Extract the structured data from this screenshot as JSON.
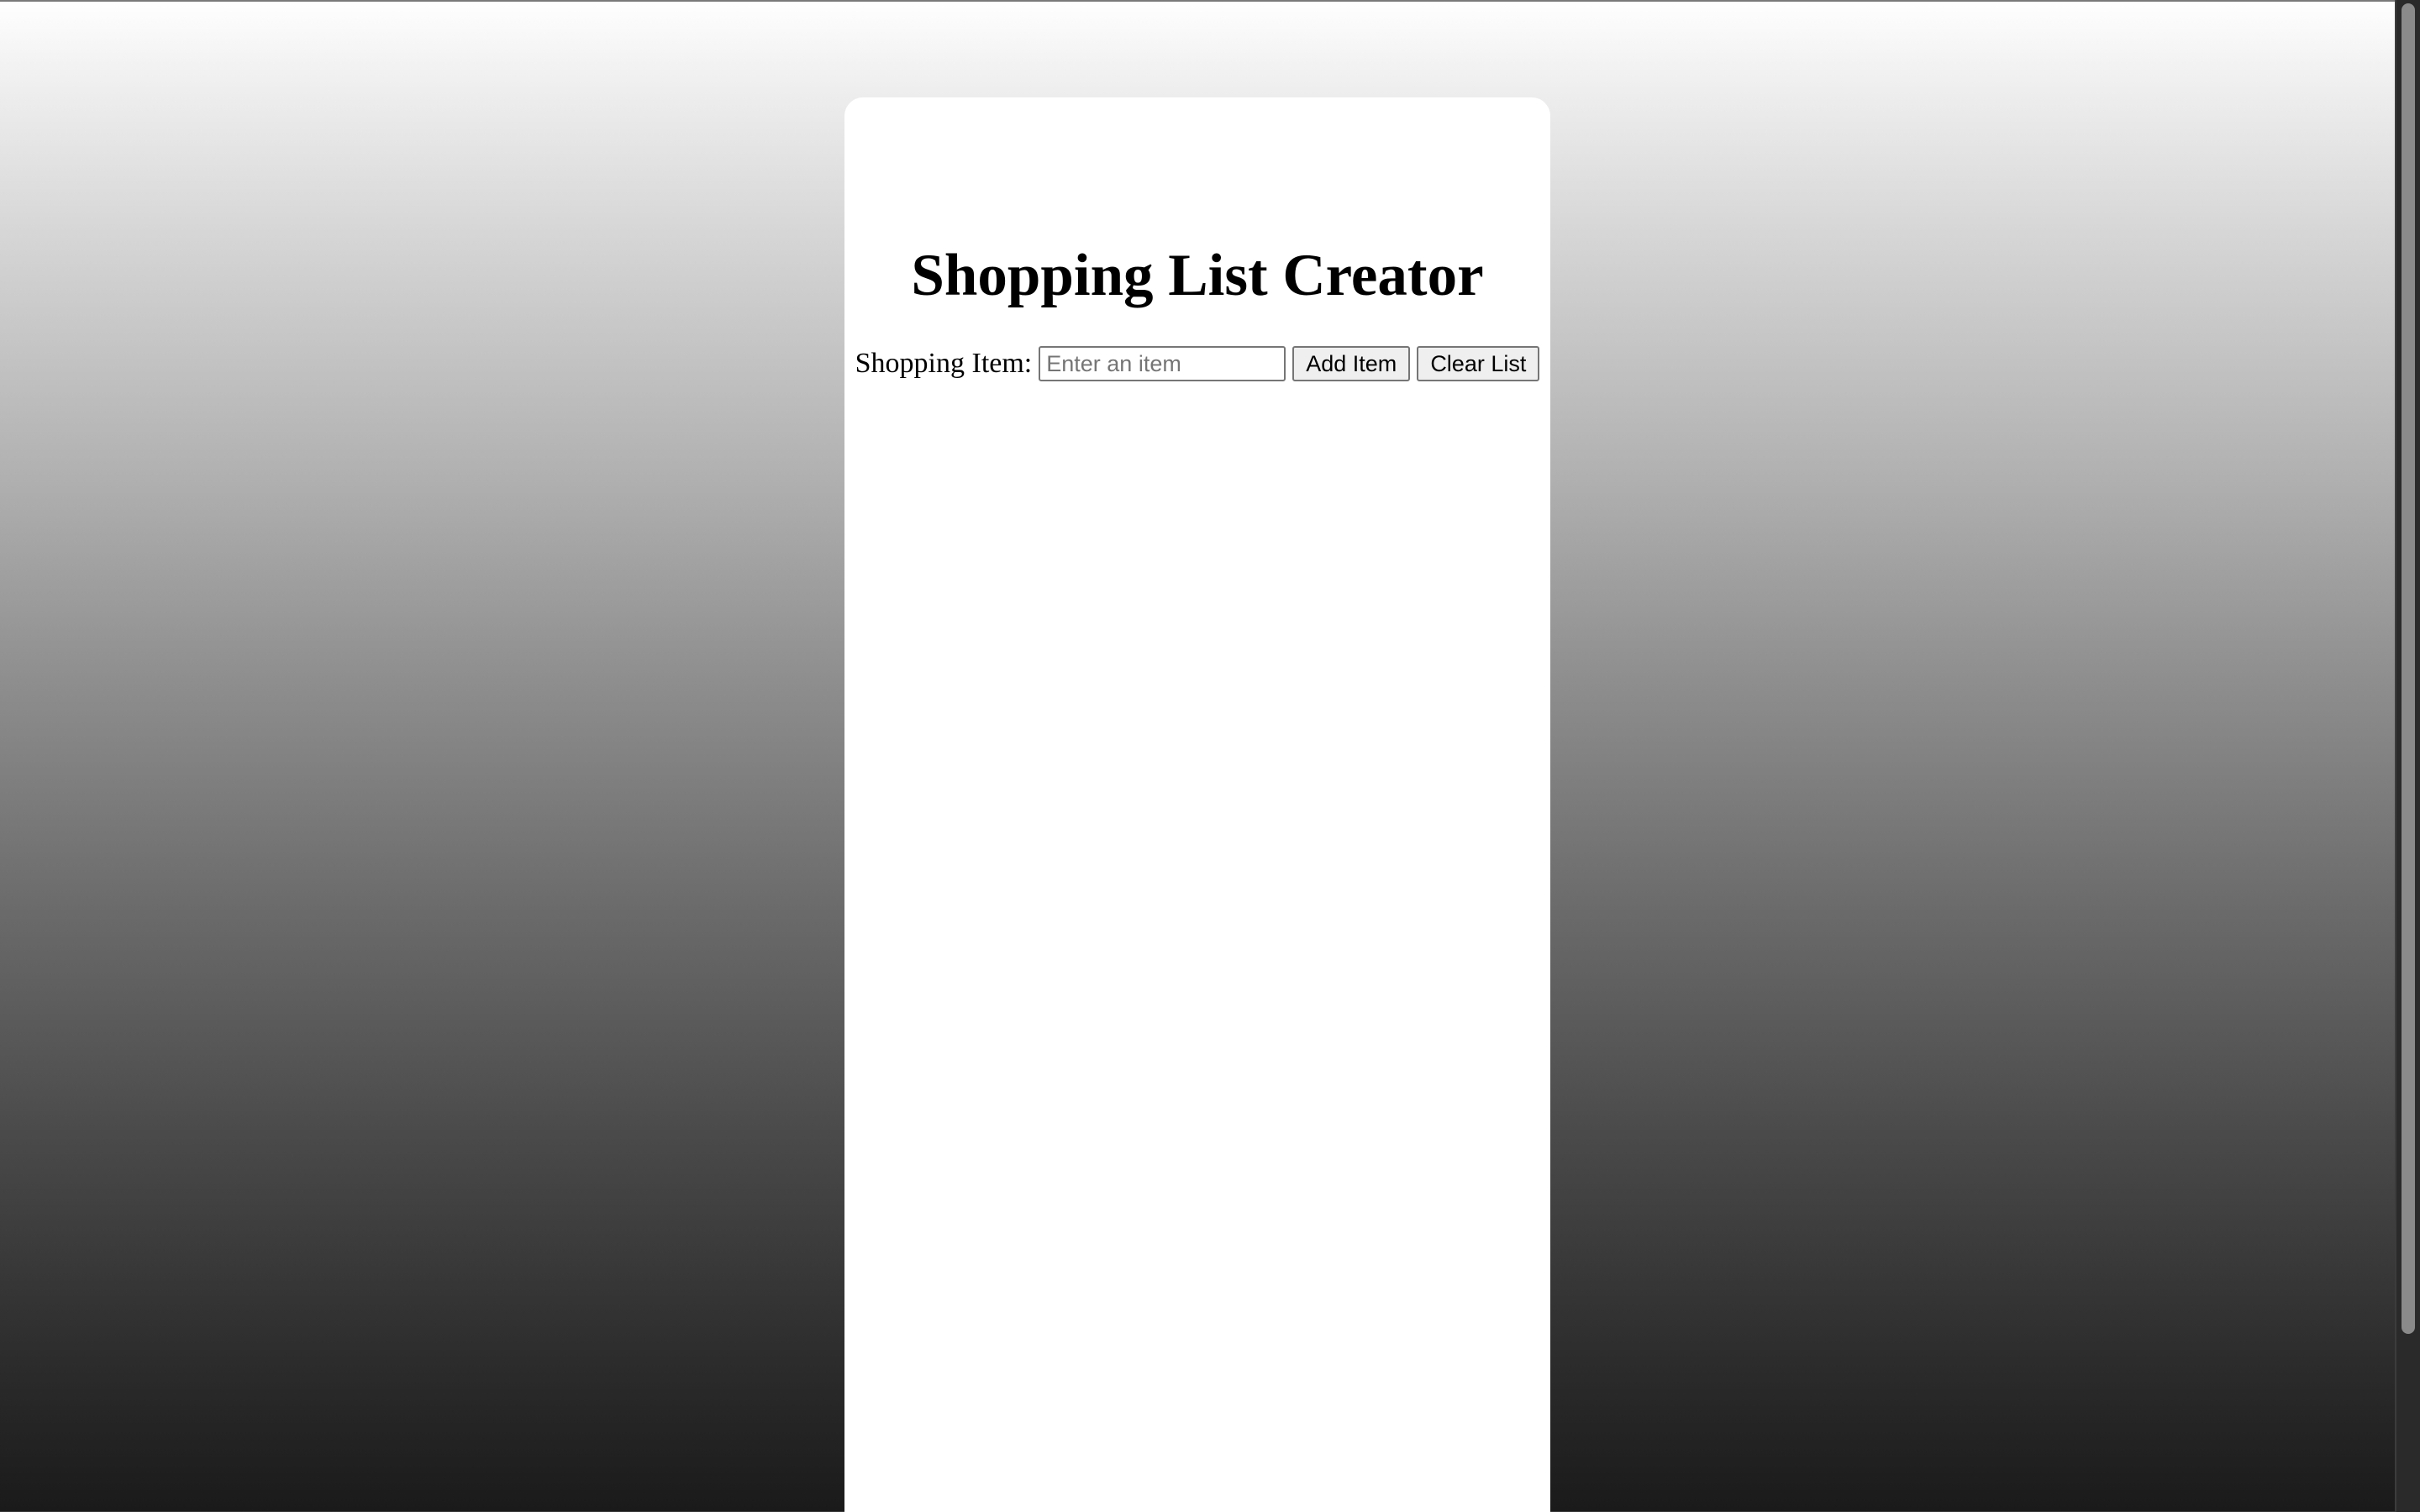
{
  "page": {
    "title": "Shopping List Creator"
  },
  "form": {
    "label": "Shopping Item:",
    "input_value": "",
    "input_placeholder": "Enter an item",
    "add_button_label": "Add Item",
    "clear_button_label": "Clear List"
  },
  "shopping_list": {
    "items": []
  },
  "colors": {
    "card_background": "#ffffff",
    "button_background": "#efefef",
    "gradient_top": "#ffffff",
    "gradient_bottom": "#1a1a1a"
  }
}
